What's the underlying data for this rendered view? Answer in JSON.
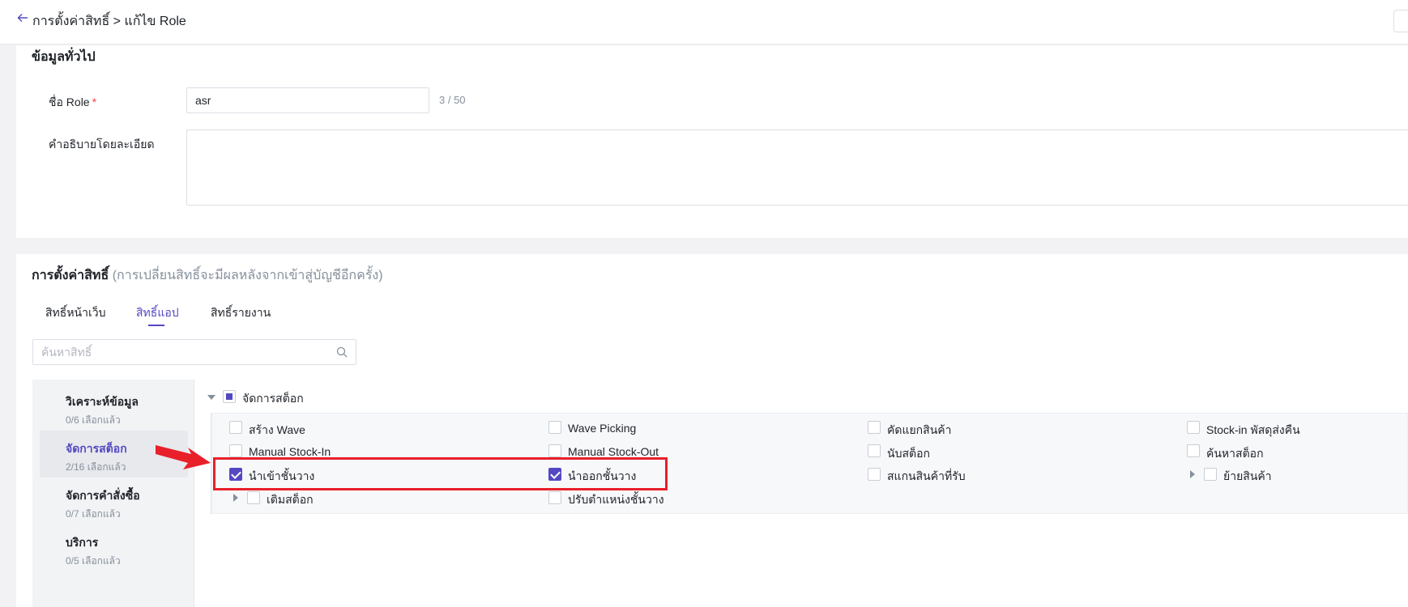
{
  "header": {
    "breadcrumb": "การตั้งค่าสิทธิ์ > แก้ไข Role"
  },
  "general": {
    "title": "ข้อมูลทั่วไป",
    "role_name_label": "ชื่อ Role",
    "required_mark": "*",
    "role_name_value": "asr",
    "role_name_counter": "3 / 50",
    "description_label": "คำอธิบายโดยละเอียด",
    "description_value": ""
  },
  "permissions": {
    "title": "การตั้งค่าสิทธิ์",
    "subtitle": "(การเปลี่ยนสิทธิ์จะมีผลหลังจากเข้าสู่บัญชีอีกครั้ง)",
    "tabs": [
      {
        "label": "สิทธิ์หน้าเว็บ",
        "active": false
      },
      {
        "label": "สิทธิ์แอป",
        "active": true
      },
      {
        "label": "สิทธิ์รายงาน",
        "active": false
      }
    ],
    "search_placeholder": "ค้นหาสิทธิ์",
    "categories": [
      {
        "name": "วิเคราะห์ข้อมูล",
        "count": "0/6 เลือกแล้ว",
        "active": false
      },
      {
        "name": "จัดการสต็อก",
        "count": "2/16 เลือกแล้ว",
        "active": true
      },
      {
        "name": "จัดการคำสั่งซื้อ",
        "count": "0/7 เลือกแล้ว",
        "active": false
      },
      {
        "name": "บริการ",
        "count": "0/5 เลือกแล้ว",
        "active": false
      }
    ],
    "group": {
      "label": "จัดการสต็อก",
      "state": "indeterminate"
    },
    "items": [
      {
        "label": "สร้าง Wave",
        "checked": false
      },
      {
        "label": "Wave Picking",
        "checked": false
      },
      {
        "label": "คัดแยกสินค้า",
        "checked": false
      },
      {
        "label": "Stock-in พัสดุส่งคืน",
        "checked": false
      },
      {
        "label": "Manual Stock-In",
        "checked": false
      },
      {
        "label": "Manual Stock-Out",
        "checked": false
      },
      {
        "label": "นับสต็อก",
        "checked": false
      },
      {
        "label": "ค้นหาสต็อก",
        "checked": false
      },
      {
        "label": "นำเข้าชั้นวาง",
        "checked": true
      },
      {
        "label": "นำออกชั้นวาง",
        "checked": true
      },
      {
        "label": "สแกนสินค้าที่รับ",
        "checked": false
      },
      {
        "label": "ย้ายสินค้า",
        "checked": false
      },
      {
        "label": "เติมสต็อก",
        "checked": false
      },
      {
        "label": "ปรับตำแหน่งชั้นวาง",
        "checked": false
      }
    ]
  },
  "colors": {
    "accent": "#5348c2",
    "highlight": "#e8202a"
  }
}
